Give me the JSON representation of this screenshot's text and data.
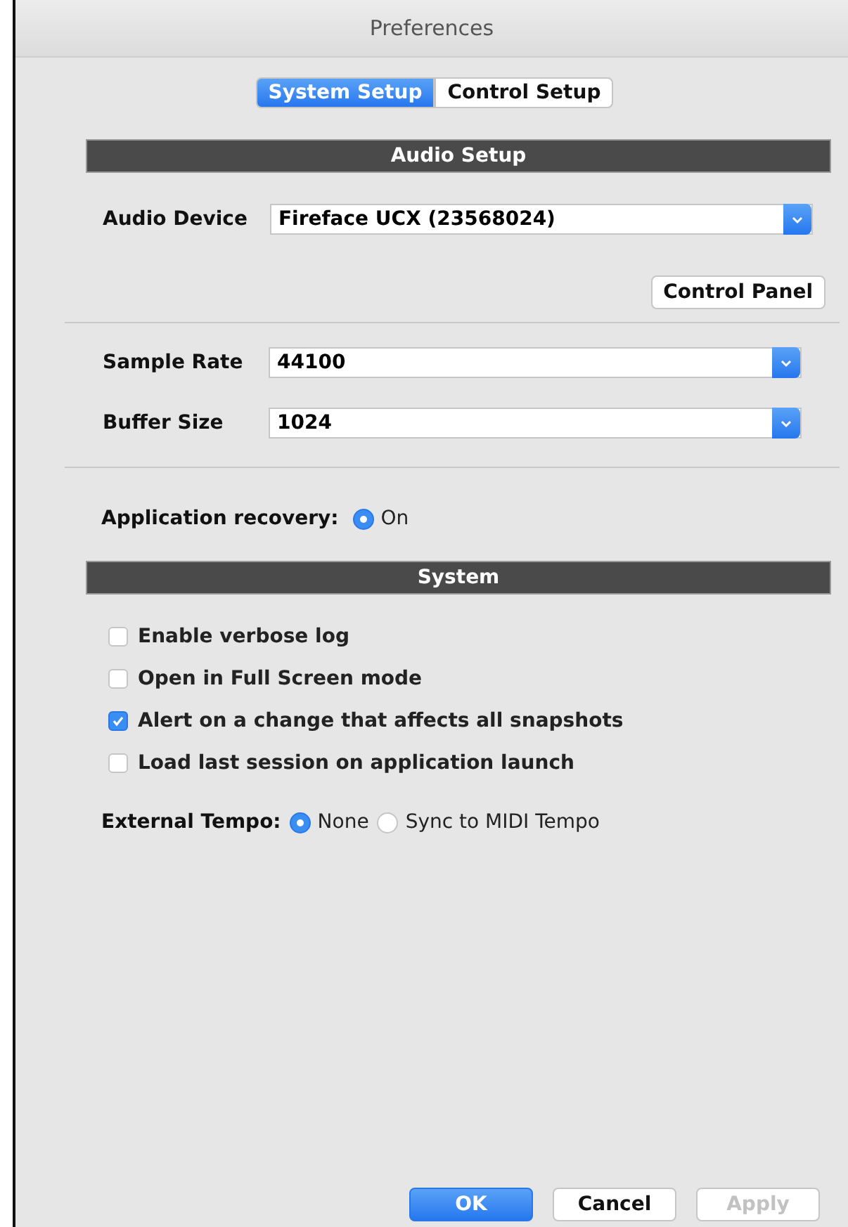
{
  "window": {
    "title": "Preferences"
  },
  "tabs": [
    {
      "label": "System Setup",
      "selected": true
    },
    {
      "label": "Control Setup",
      "selected": false
    }
  ],
  "audio_setup": {
    "heading": "Audio Setup",
    "audio_device": {
      "label": "Audio Device",
      "value": "Fireface UCX (23568024)"
    },
    "control_panel_button": "Control Panel",
    "sample_rate": {
      "label": "Sample Rate",
      "value": "44100"
    },
    "buffer_size": {
      "label": "Buffer Size",
      "value": "1024"
    },
    "application_recovery": {
      "label": "Application recovery:",
      "options": [
        {
          "label": "On",
          "selected": true
        }
      ]
    }
  },
  "system": {
    "heading": "System",
    "options": [
      {
        "label": "Enable verbose log",
        "checked": false
      },
      {
        "label": "Open in Full Screen mode",
        "checked": false
      },
      {
        "label": "Alert on a change that affects all snapshots",
        "checked": true
      },
      {
        "label": "Load last session on application launch",
        "checked": false
      }
    ],
    "external_tempo": {
      "label": "External Tempo:",
      "options": [
        {
          "label": "None",
          "selected": true
        },
        {
          "label": "Sync to MIDI Tempo",
          "selected": false
        }
      ]
    }
  },
  "buttons": [
    {
      "label": "OK",
      "default": true,
      "disabled": false
    },
    {
      "label": "Cancel",
      "default": false,
      "disabled": false
    },
    {
      "label": "Apply",
      "default": false,
      "disabled": true
    }
  ]
}
